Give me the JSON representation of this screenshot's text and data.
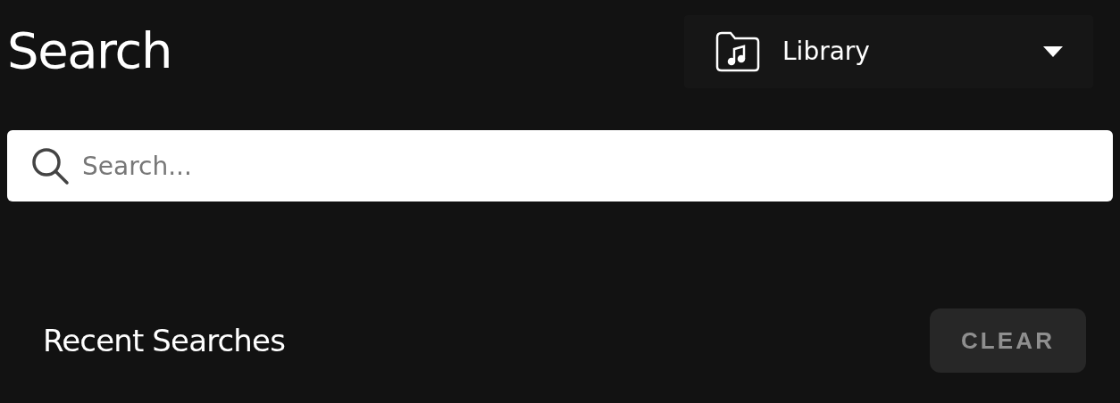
{
  "title": "Search",
  "source_dropdown": {
    "value": "Library"
  },
  "search": {
    "placeholder": "Search..."
  },
  "recent": {
    "heading": "Recent Searches",
    "clear_button": "CLEAR"
  }
}
